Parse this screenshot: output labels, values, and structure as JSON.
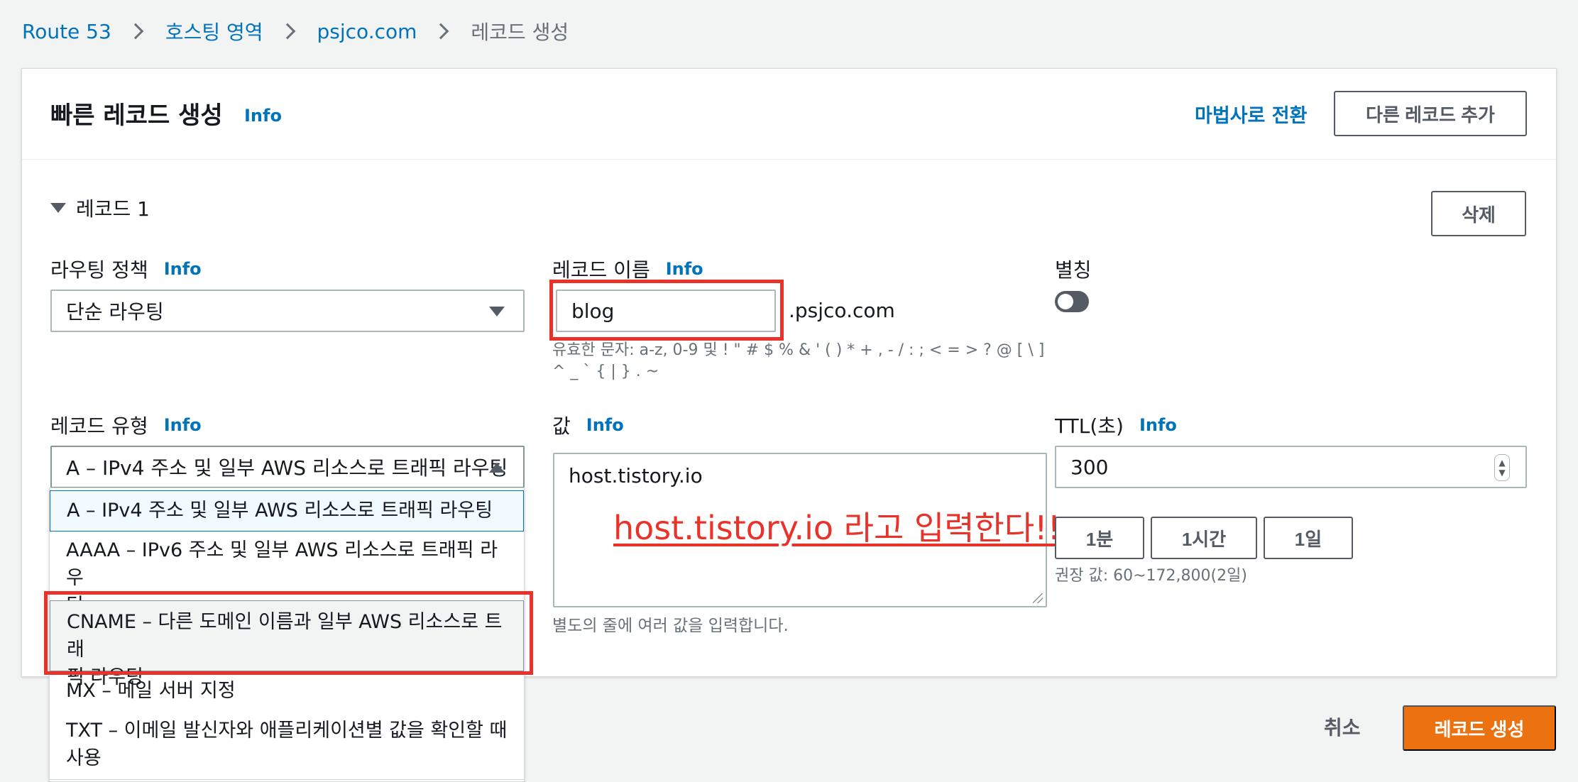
{
  "breadcrumb": {
    "items": [
      "Route 53",
      "호스팅 영역",
      "psjco.com"
    ],
    "current": "레코드 생성"
  },
  "panel": {
    "title": "빠른 레코드 생성",
    "info": "Info",
    "wizard_link": "마법사로 전환",
    "add_record_button": "다른 레코드 추가"
  },
  "record": {
    "toggle_label": "레코드 1",
    "delete_button": "삭제",
    "routing_policy": {
      "label": "라우팅 정책",
      "info": "Info",
      "value": "단순 라우팅"
    },
    "record_name": {
      "label": "레코드 이름",
      "info": "Info",
      "value": "blog",
      "suffix": ".psjco.com",
      "hint_line1": "유효한 문자: a-z, 0-9 및 ! \" # $ % & ' ( ) * + , - / : ; < = > ? @ [ \\ ]",
      "hint_line2": "^ _ ` { | } . ~"
    },
    "alias": {
      "label": "별칭",
      "enabled": false
    },
    "record_type": {
      "label": "레코드 유형",
      "info": "Info",
      "value": "A – IPv4 주소 및 일부 AWS 리소스로 트래픽 라우팅",
      "options": [
        {
          "line1": "A – IPv4 주소 및 일부 AWS 리소스로 트래픽 라우팅",
          "line2": ""
        },
        {
          "line1": "AAAA – IPv6 주소 및 일부 AWS 리소스로 트래픽 라우",
          "line2": "팅"
        },
        {
          "line1": "CNAME – 다른 도메인 이름과 일부 AWS 리소스로 트래",
          "line2": "픽 라우팅"
        },
        {
          "line1": "MX – 메일 서버 지정",
          "line2": ""
        },
        {
          "line1": "TXT – 이메일 발신자와 애플리케이션별 값을 확인할 때",
          "line2": "사용"
        }
      ]
    },
    "value": {
      "label": "값",
      "info": "Info",
      "content": "host.tistory.io",
      "hint": "별도의 줄에 여러 값을 입력합니다."
    },
    "ttl": {
      "label": "TTL(초)",
      "info": "Info",
      "value": "300",
      "quick_buttons": [
        "1분",
        "1시간",
        "1일"
      ],
      "hint": "권장 값: 60~172,800(2일)"
    }
  },
  "annotation": {
    "text": "host.tistory.io 라고 입력한다!!",
    "color": "#e8322a"
  },
  "footer": {
    "cancel": "취소",
    "create": "레코드 생성"
  },
  "colors": {
    "link": "#0073bb",
    "primary": "#ec7211",
    "highlight_box": "#e8322a",
    "background": "#f2f3f3"
  },
  "icons": [
    "chevron-right-icon",
    "triangle-down-icon",
    "caret-down-icon",
    "caret-up-icon",
    "spinner-icon",
    "resize-handle-icon"
  ]
}
